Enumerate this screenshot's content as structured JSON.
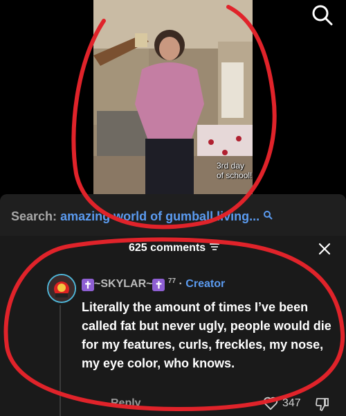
{
  "video": {
    "caption": "3rd day of school!"
  },
  "search": {
    "prefix": "Search:",
    "query": "amazing world of gumball living..."
  },
  "comments": {
    "count_label": "625 comments"
  },
  "comment": {
    "username": "~SKYLAR~",
    "superscript": "77",
    "separator": "·",
    "creator_tag": "Creator",
    "text": "Literally the amount of times I’ve been called fat but never ugly, people would die for my features, curls, freckles, my nose, my eye color, who knows.",
    "reply_label": "Reply",
    "like_count": "347"
  },
  "icons": {
    "search": "search-icon",
    "close": "close-icon",
    "sort": "sort-icon",
    "heart": "heart-icon",
    "dislike": "thumbs-down-icon"
  },
  "colors": {
    "accent_blue": "#5b9bf0",
    "annotation_red": "#e0232a",
    "cross_purple": "#8e5fd3"
  }
}
